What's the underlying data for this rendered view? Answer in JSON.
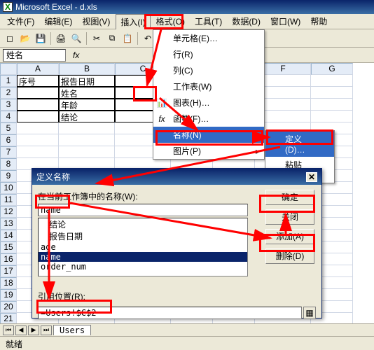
{
  "app": {
    "title": "Microsoft Excel - d.xls",
    "icon_glyph": "X"
  },
  "menubar": {
    "items": [
      {
        "label": "文件(F)"
      },
      {
        "label": "编辑(E)"
      },
      {
        "label": "视图(V)"
      },
      {
        "label": "插入(I)",
        "active": true
      },
      {
        "label": "格式(O)"
      },
      {
        "label": "工具(T)"
      },
      {
        "label": "数据(D)"
      },
      {
        "label": "窗口(W)"
      },
      {
        "label": "帮助"
      }
    ]
  },
  "toolbar": {
    "icons": [
      "new",
      "open",
      "save",
      "print",
      "preview",
      "spell",
      "cut",
      "copy",
      "paste",
      "undo",
      "redo",
      "sum",
      "sort-asc",
      "sort-desc",
      "chart"
    ]
  },
  "namebox": {
    "value": "姓名"
  },
  "columns": [
    "A",
    "B",
    "C",
    "D",
    "E",
    "F",
    "G"
  ],
  "rows_count": 22,
  "cells": {
    "A1": "序号",
    "B1": "报告日期",
    "B2": "姓名",
    "B3": "年龄",
    "B4": "结论"
  },
  "insert_menu": {
    "items": [
      {
        "label": "单元格(E)…"
      },
      {
        "label": "行(R)"
      },
      {
        "label": "列(C)"
      },
      {
        "label": "工作表(W)"
      },
      {
        "label": "图表(H)…",
        "icon": "📊"
      },
      {
        "label": "函数(F)…",
        "icon": "fx"
      },
      {
        "label": "名称(N)",
        "highlight": true,
        "submenu": true
      },
      {
        "label": "图片(P)",
        "submenu": true
      }
    ],
    "submenu": {
      "items": [
        {
          "label": "定义(D)…",
          "highlight": true
        },
        {
          "label": "粘贴(P)…"
        }
      ]
    }
  },
  "dialog": {
    "title": "定义名称",
    "label_names": "在当前工作簿中的名称(W):",
    "name_value": "name",
    "list": [
      {
        "label": "结论"
      },
      {
        "label": "报告日期"
      },
      {
        "label": "age"
      },
      {
        "label": "name",
        "selected": true
      },
      {
        "label": "order_num"
      }
    ],
    "label_ref": "引用位置(R):",
    "ref_value": "=Users!$C$2",
    "buttons": {
      "ok": "确定",
      "close": "关闭",
      "add": "添加(A)",
      "delete": "删除(D)"
    }
  },
  "tabs": {
    "sheet": "Users"
  },
  "status": {
    "text": "就绪"
  }
}
